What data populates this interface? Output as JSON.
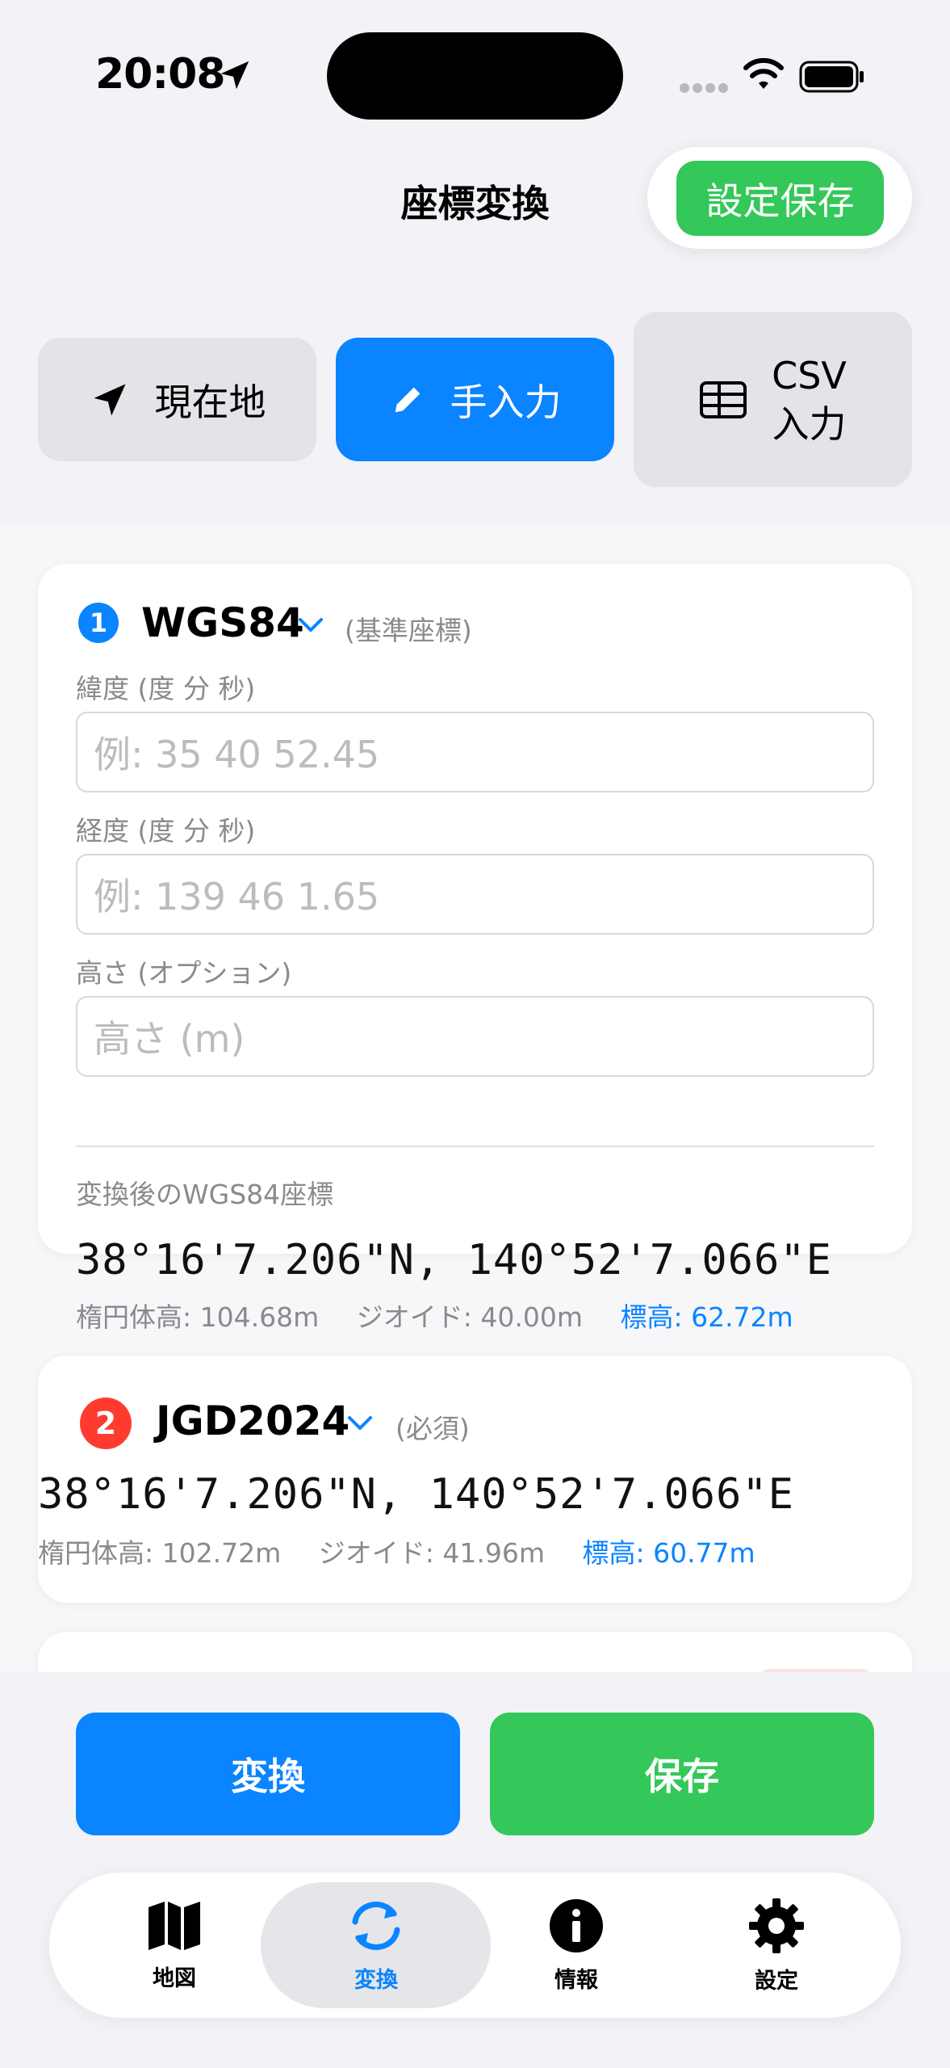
{
  "status_bar": {
    "time": "20:08"
  },
  "header": {
    "title": "座標変換",
    "save_settings_label": "設定保存"
  },
  "modes": {
    "current_location": "現在地",
    "manual_input": "手入力",
    "csv_line1": "CSV",
    "csv_line2": "入力",
    "selected": "manual_input"
  },
  "card1": {
    "index": "1",
    "system": "WGS84",
    "note": "(基準座標)",
    "lat_label": "緯度 (度 分 秒)",
    "lat_placeholder": "例: 35 40 52.45",
    "lon_label": "経度 (度 分 秒)",
    "lon_placeholder": "例: 139 46 1.65",
    "height_label": "高さ (オプション)",
    "height_placeholder": "高さ (m)",
    "result_label": "変換後のWGS84座標",
    "coord": "38°16'7.206\"N, 140°52'7.066\"E",
    "ellipsoid_height": "楕円体高: 104.68m",
    "geoid": "ジオイド: 40.00m",
    "orthometric": "標高: 62.72m"
  },
  "card2": {
    "index": "2",
    "system": "JGD2024",
    "note": "(必須)",
    "coord": "38°16'7.206\"N, 140°52'7.066\"E",
    "ellipsoid_height": "楕円体高: 102.72m",
    "geoid": "ジオイド: 41.96m",
    "orthometric": "標高: 60.77m"
  },
  "actions": {
    "convert": "変換",
    "save": "保存"
  },
  "tabs": [
    {
      "label": "地図",
      "icon": "map-icon"
    },
    {
      "label": "変換",
      "icon": "convert-icon",
      "active": true
    },
    {
      "label": "情報",
      "icon": "info-icon"
    },
    {
      "label": "設定",
      "icon": "gear-icon"
    }
  ],
  "colors": {
    "accent_blue": "#0a84ff",
    "accent_green": "#34c759",
    "badge_red": "#ff3b30"
  }
}
